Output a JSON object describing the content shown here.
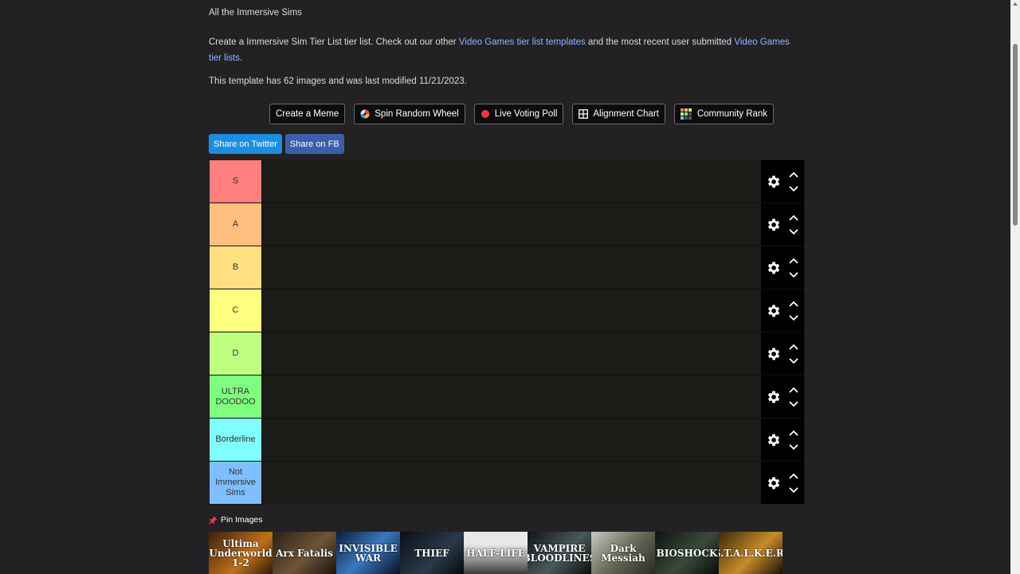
{
  "header": {
    "subtitle": "All the Immersive Sims",
    "desc_part1": "Create a Immersive Sim Tier List tier list. Check out our other ",
    "desc_link1": "Video Games tier list templates",
    "desc_part2": " and the most recent user submitted ",
    "desc_link2": "Video Games tier lists",
    "desc_part3": ".",
    "meta": "This template has 62 images and was last modified 11/21/2023."
  },
  "tools": [
    {
      "label": "Create a Meme",
      "icon": "none"
    },
    {
      "label": "Spin Random Wheel",
      "icon": "wheel-icon"
    },
    {
      "label": "Live Voting Poll",
      "icon": "red-dot-icon"
    },
    {
      "label": "Alignment Chart",
      "icon": "grid-icon"
    },
    {
      "label": "Community Rank",
      "icon": "color-grid-icon"
    }
  ],
  "share": {
    "twitter": "Share on Twitter",
    "fb": "Share on FB"
  },
  "tiers": [
    {
      "label": "S",
      "color": "#ff7f7f"
    },
    {
      "label": "A",
      "color": "#ffbf7f"
    },
    {
      "label": "B",
      "color": "#ffdf7f"
    },
    {
      "label": "C",
      "color": "#ffff7f"
    },
    {
      "label": "D",
      "color": "#bfff7f"
    },
    {
      "label": "ULTRA DOODOO",
      "color": "#7fff7f"
    },
    {
      "label": "Borderline",
      "color": "#7fffff"
    },
    {
      "label": "Not Immersive Sims",
      "color": "#7fbfff"
    }
  ],
  "pin_label": "Pin Images",
  "images": [
    {
      "text": "Ultima Underworld 1-2",
      "bg": "linear-gradient(135deg,#3a2010,#c0701a 60%,#2a1a0a)"
    },
    {
      "text": "Arx Fatalis",
      "bg": "linear-gradient(135deg,#2a2018,#6e5436 55%,#1a140e)"
    },
    {
      "text": "INVISIBLE WAR",
      "bg": "linear-gradient(135deg,#0c1c3a,#3a78c0 50%,#0a1020)"
    },
    {
      "text": "THIEF",
      "bg": "linear-gradient(135deg,#0a0f14,#2a3a4a 60%,#05080a)"
    },
    {
      "text": "HALF-LIFE",
      "bg": "linear-gradient(180deg,#e8e8e8 30%,#8a8a8a 70%,#3a3a3a)"
    },
    {
      "text": "VAMPIRE BLOODLINES",
      "bg": "linear-gradient(135deg,#101418,#4a5a5a 55%,#0c0c0c)"
    },
    {
      "text": "Dark Messiah",
      "bg": "linear-gradient(135deg,#c8c8c0,#6a6a5a 50%,#2a2a20)"
    },
    {
      "text": "BIOSHOCK",
      "bg": "linear-gradient(135deg,#0c1410,#3a4a3a 55%,#080c0a)"
    },
    {
      "text": "S.T.A.L.K.E.R.",
      "bg": "linear-gradient(135deg,#3a2a0a,#c88a2a 55%,#1a1205)"
    }
  ]
}
